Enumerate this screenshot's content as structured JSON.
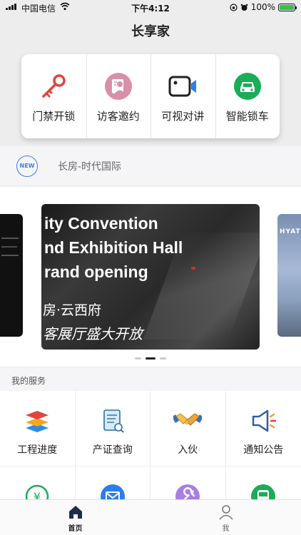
{
  "status_bar": {
    "carrier": "中国电信",
    "time": "下午4:12",
    "battery": "100%"
  },
  "nav": {
    "title": "长享家"
  },
  "quick_actions": [
    {
      "label": "门禁开锁",
      "icon": "key-icon"
    },
    {
      "label": "访客邀约",
      "icon": "visitor-icon"
    },
    {
      "label": "可视对讲",
      "icon": "video-call-icon"
    },
    {
      "label": "智能锁车",
      "icon": "car-lock-icon"
    }
  ],
  "community": {
    "badge": "NEW",
    "name": "长房-时代国际"
  },
  "banner": {
    "main": {
      "line1": "ity Convention",
      "line2": "nd Exhibition Hall",
      "line3": "rand opening",
      "line4": "房·云西府",
      "line5": "客展厅盛大开放"
    },
    "left": {
      "text": ""
    },
    "right": {
      "text": "HYATT"
    },
    "active_index": 1,
    "count": 3
  },
  "services": {
    "title": "我的服务",
    "items": [
      {
        "label": "工程进度",
        "icon": "layers-icon"
      },
      {
        "label": "产证查询",
        "icon": "certificate-icon"
      },
      {
        "label": "入伙",
        "icon": "handshake-icon"
      },
      {
        "label": "通知公告",
        "icon": "megaphone-icon"
      },
      {
        "label": "",
        "icon": "payment-icon"
      },
      {
        "label": "",
        "icon": "mail-icon"
      },
      {
        "label": "",
        "icon": "wrench-icon"
      },
      {
        "label": "",
        "icon": "bus-icon"
      }
    ]
  },
  "tabs": [
    {
      "label": "首页",
      "icon": "home-icon",
      "active": true
    },
    {
      "label": "我",
      "icon": "user-icon",
      "active": false
    }
  ],
  "colors": {
    "accent": "#3b7ef0",
    "key_red": "#e0443d",
    "car_green": "#1aad57",
    "battery_green": "#32c24d"
  }
}
